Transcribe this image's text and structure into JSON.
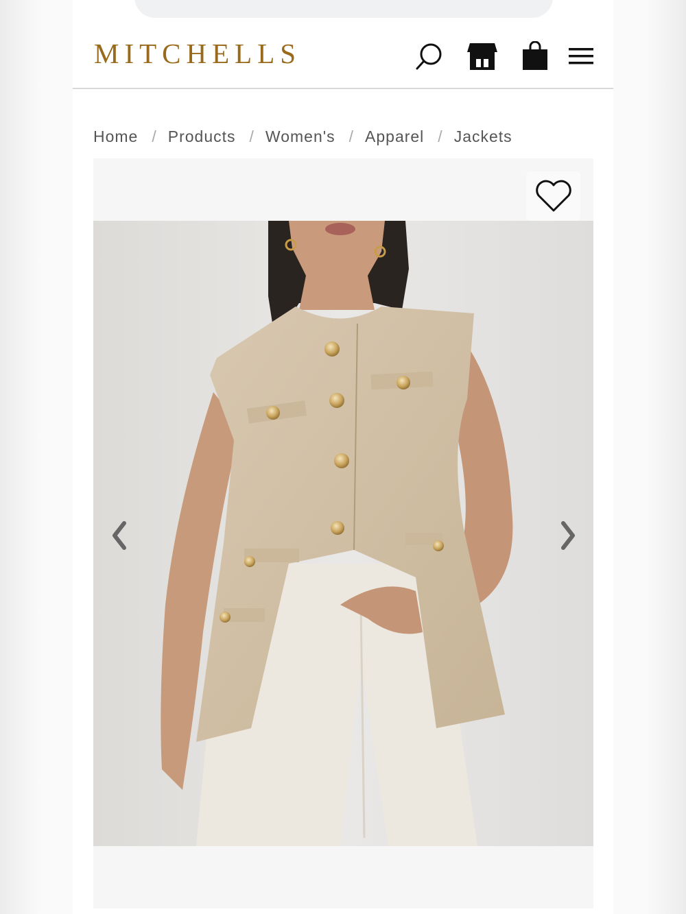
{
  "brand": {
    "logo_text": "MITCHELLS",
    "logo_color": "#9a6a1c"
  },
  "header": {
    "icons": [
      "search-icon",
      "store-icon",
      "shopping-bag-icon",
      "menu-icon"
    ]
  },
  "breadcrumb": {
    "items": [
      "Home",
      "Products",
      "Women's",
      "Apparel",
      "Jackets"
    ],
    "separator": "/"
  },
  "gallery": {
    "wishlist_icon": "heart-outline-icon",
    "prev_icon": "chevron-left-icon",
    "next_icon": "chevron-right-icon",
    "prev_glyph": "‹",
    "next_glyph": "›"
  }
}
